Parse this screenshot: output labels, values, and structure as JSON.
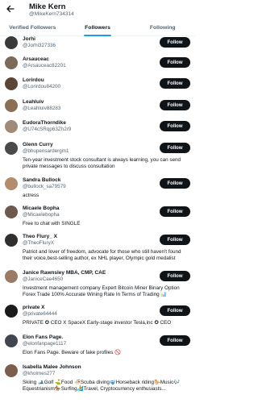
{
  "header": {
    "name": "Mike Kern",
    "handle": "@MikeKern734314"
  },
  "tabs": [
    {
      "label": "Verified Followers"
    },
    {
      "label": "Followers"
    },
    {
      "label": "Following"
    }
  ],
  "follow_label": "Follow",
  "users": [
    {
      "name": "Jorhi",
      "handle": "@Jorhi327336",
      "bio": "",
      "avatar_color": "#3a3a3a"
    },
    {
      "name": "Arsauceac",
      "handle": "@Arsauceac82201",
      "bio": "",
      "avatar_color": "#7a6b5a"
    },
    {
      "name": "Lorirdou",
      "handle": "@Lorirdou84200",
      "bio": "",
      "avatar_color": "#5b4636"
    },
    {
      "name": "Leahluiv",
      "handle": "@Leahluiv88283",
      "bio": "",
      "avatar_color": "#8a6f55"
    },
    {
      "name": "EudoraThorndike",
      "handle": "@U74cSRqp63Zh2r9",
      "bio": "",
      "avatar_color": "#a08a78"
    },
    {
      "name": "Glenn Curry",
      "handle": "@bhupensardergm1",
      "bio": "Ten-year investment stock consultant is always learning, you can send private messages to discuss consultation",
      "avatar_color": "#4a4a4a"
    },
    {
      "name": "Sandra Bullock",
      "handle": "@bullock_sa79579",
      "bio": "actress",
      "avatar_color": "#b38b6d"
    },
    {
      "name": "Micaele Bopha",
      "handle": "@Micaelebopha",
      "bio": "Free to chat with SINGLE",
      "avatar_color": "#6d5a4d"
    },
    {
      "name": "Theo Flury_ X",
      "handle": "@TheoFluryX",
      "bio": "Patriot and lover of freedom, advocate for those who still haven't found their voice,best-selling author, ex NHL player, Olympic gold medalist",
      "avatar_color": "#2f2f2f"
    },
    {
      "name": "Janice Rawnsley MBA, CMP, CAE",
      "handle": "@JaniceCae4650",
      "bio": "Investment management company Expert Bitcoin Miner Binary Option Forex Trade 100% Accurate Wining Rate In Terms of Trading 📊",
      "avatar_color": "#9c7b66"
    },
    {
      "name": "private X",
      "handle": "@private64444",
      "bio": "PRIVATE ✪ CEO X SpaceX Early-stage investor Tesla,inc ✪ CEO",
      "avatar_color": "#1b1b1b"
    },
    {
      "name": "Elon Fans Page.",
      "handle": "@elonfanpage1117",
      "bio": "Elon Fans Page. Beware of fake profiles 🚫",
      "avatar_color": "#404550"
    },
    {
      "name": "Isabella Malee Johnson",
      "handle": "@kholmes277",
      "bio": "Skiing 🎿Golf ⛳Food 🍜Scuba diving🤿Horseback riding🐎Music🎶 Equestrianism🏇Surfing🏄Travel, Cryptocurrency enthusiasts...",
      "avatar_color": "#7b5e4c"
    }
  ]
}
